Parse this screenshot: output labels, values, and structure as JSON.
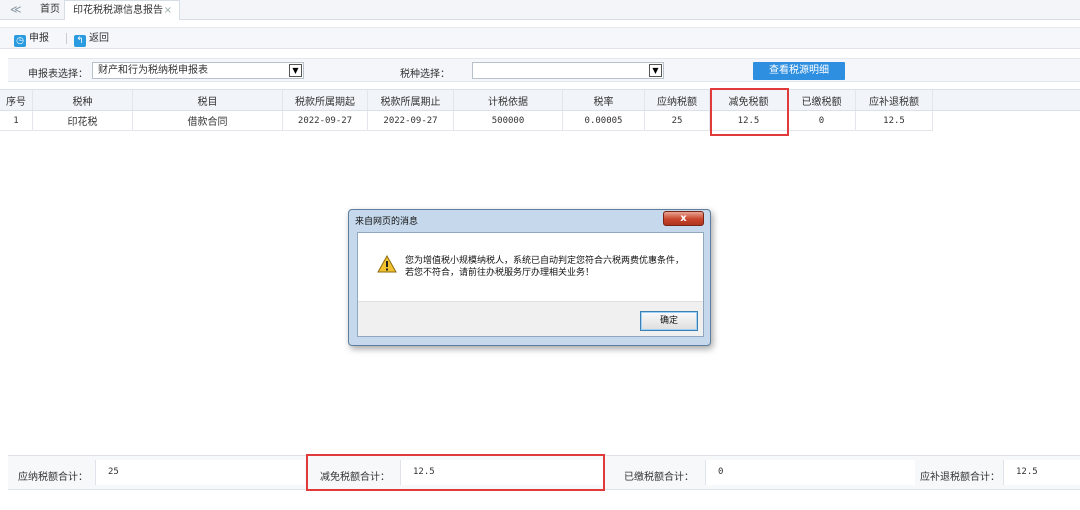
{
  "tabs": {
    "home": "首页",
    "active": "印花税税源信息报告",
    "close": "×",
    "prev": "≪"
  },
  "toolbar": {
    "declare": "申报",
    "back": "返回"
  },
  "filter": {
    "report_label": "申报表选择：",
    "report_value": "财产和行为税纳税申报表",
    "tax_label": "税种选择：",
    "tax_value": "",
    "detail_button": "查看税源明细"
  },
  "grid": {
    "headers": [
      "序号",
      "税种",
      "税目",
      "税款所属期起",
      "税款所属期止",
      "计税依据",
      "税率",
      "应纳税额",
      "减免税额",
      "已缴税额",
      "应补退税额"
    ],
    "rows": [
      [
        "1",
        "印花税",
        "借款合同",
        "2022-09-27",
        "2022-09-27",
        "500000",
        "0.00005",
        "25",
        "12.5",
        "0",
        "12.5"
      ]
    ]
  },
  "totals": {
    "payable_label": "应纳税额合计：",
    "payable_value": "25",
    "relief_label": "减免税额合计：",
    "relief_value": "12.5",
    "paid_label": "已缴税额合计：",
    "paid_value": "0",
    "refund_label": "应补退税额合计：",
    "refund_value": "12.5"
  },
  "dialog": {
    "title": "来自网页的消息",
    "close": "x",
    "line1": "您为增值税小规模纳税人，系统已自动判定您符合六税两费优惠条件，",
    "line2": "若您不符合，请前往办税服务厅办理相关业务！",
    "ok": "确定"
  },
  "colors": {
    "accent": "#2e8fe0",
    "highlight": "#e03a3a"
  }
}
